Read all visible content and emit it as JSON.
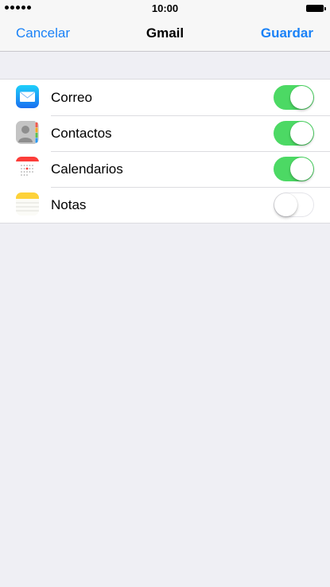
{
  "statusbar": {
    "time": "10:00",
    "signal_bars": 5
  },
  "navbar": {
    "cancel_label": "Cancelar",
    "title": "Gmail",
    "save_label": "Guardar"
  },
  "services": [
    {
      "label": "Correo",
      "icon": "mail-icon",
      "enabled": true
    },
    {
      "label": "Contactos",
      "icon": "contacts-icon",
      "enabled": true
    },
    {
      "label": "Calendarios",
      "icon": "calendar-icon",
      "enabled": true
    },
    {
      "label": "Notas",
      "icon": "notes-icon",
      "enabled": false
    }
  ],
  "colors": {
    "accent": "#1a82f7",
    "toggle_on": "#4cd964",
    "background": "#efeff4"
  }
}
